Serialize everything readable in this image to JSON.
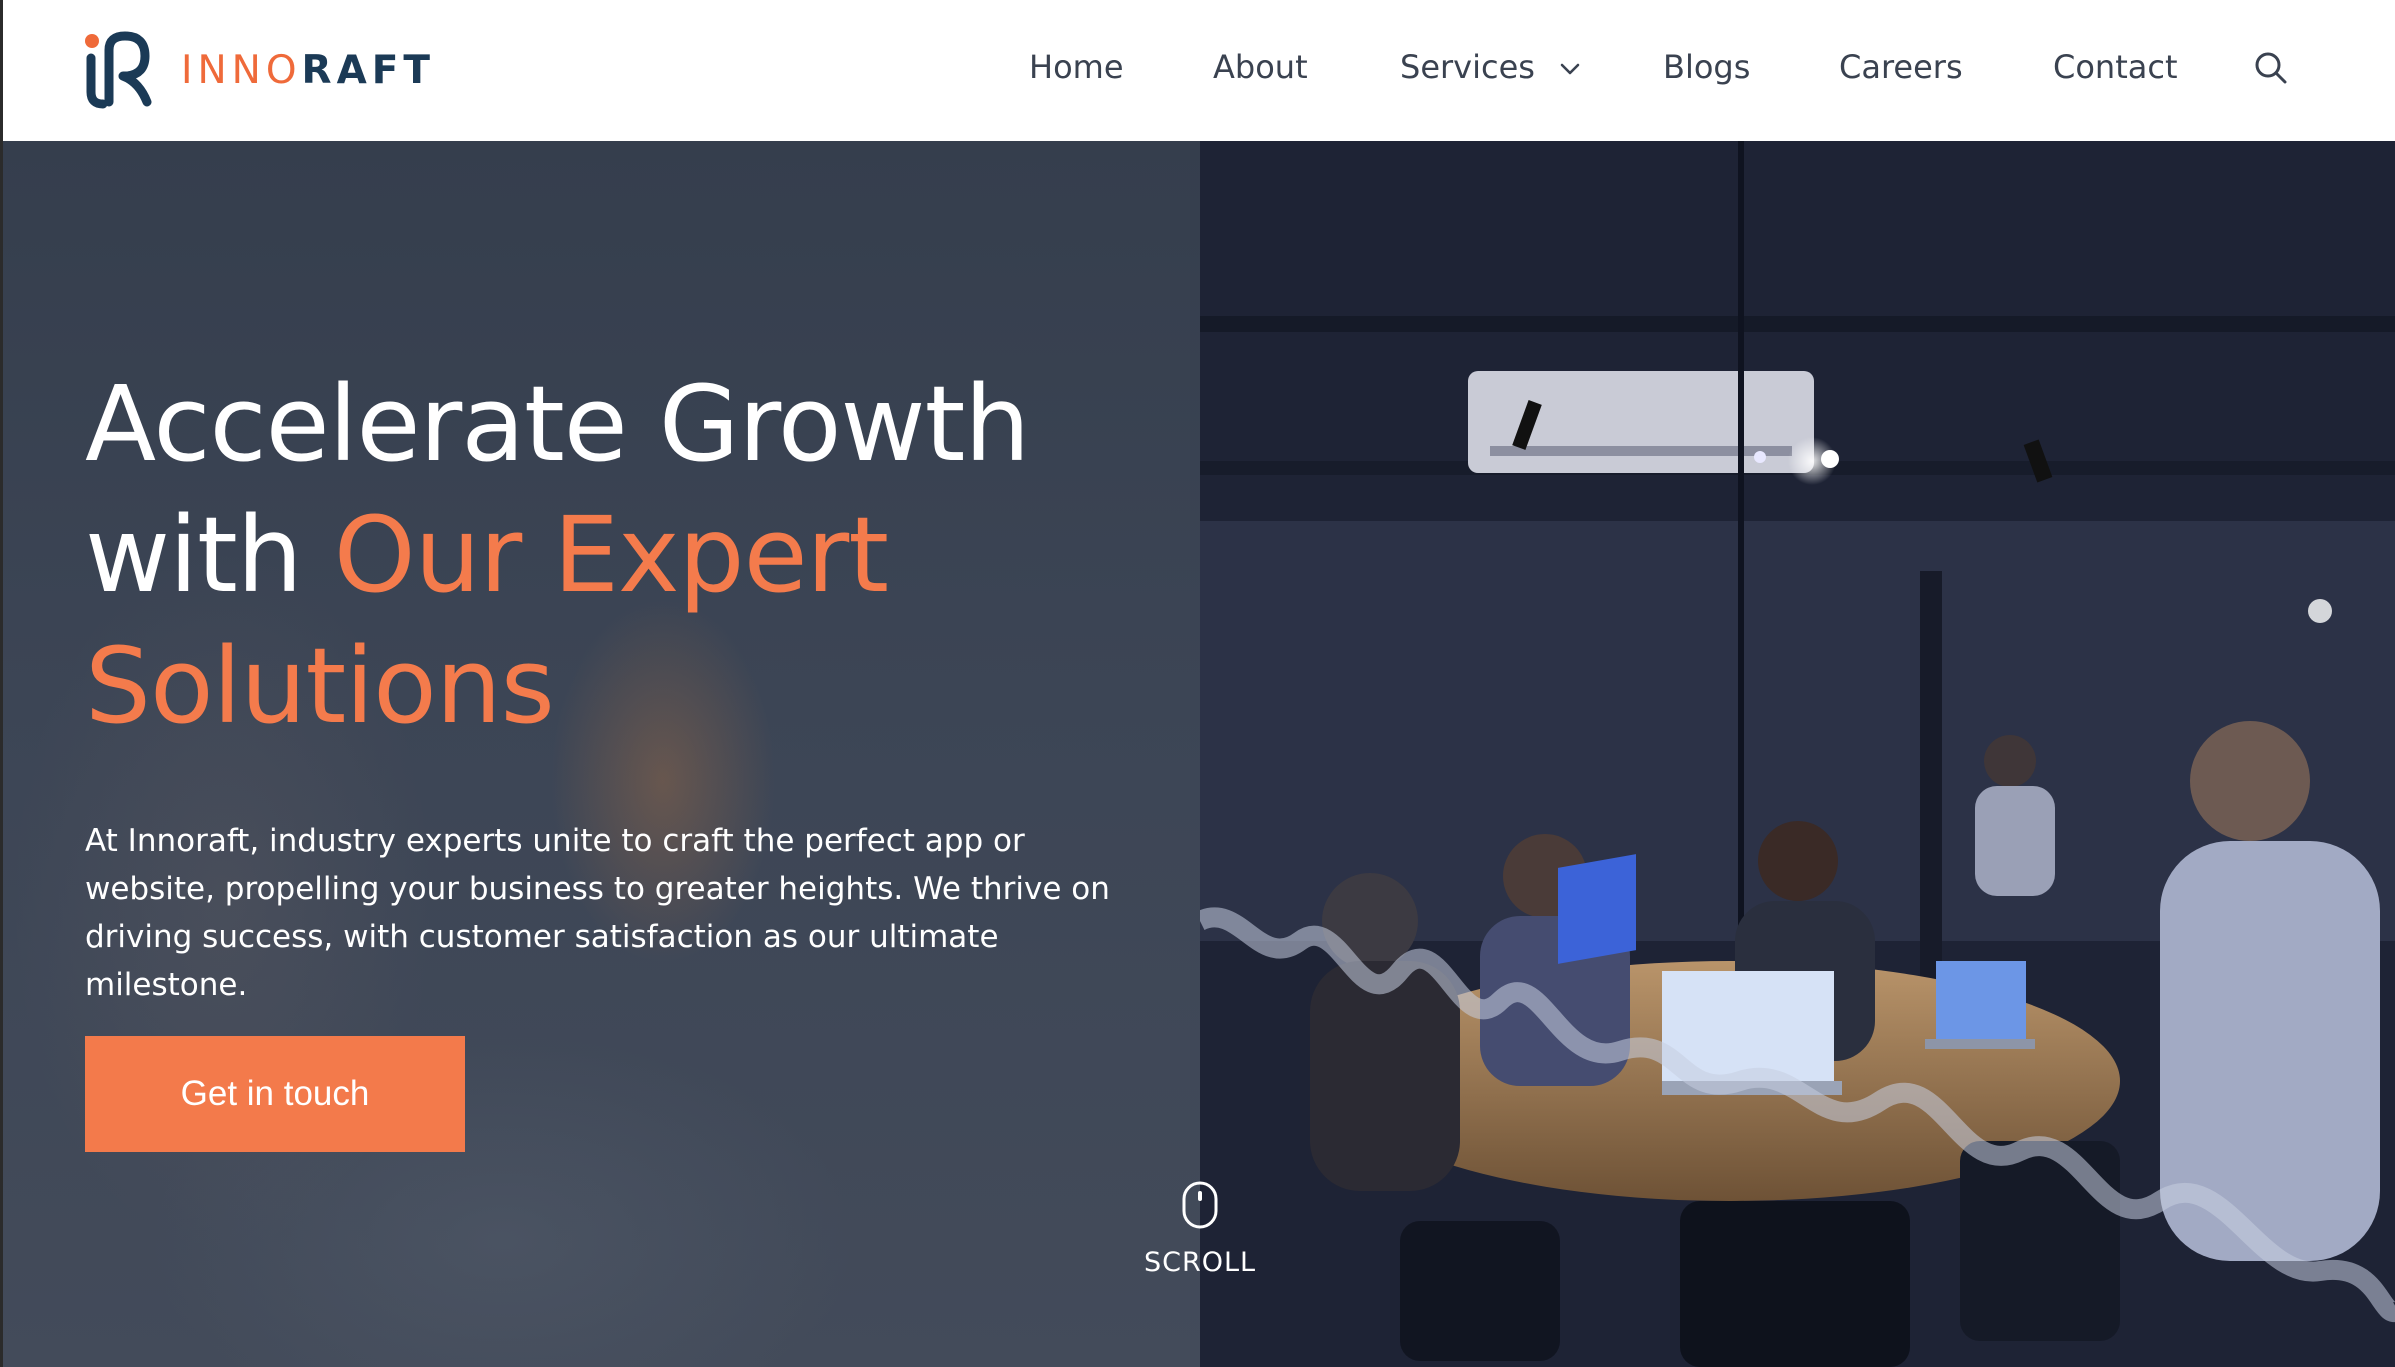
{
  "brand": {
    "name_part1": "INNO",
    "name_part2": "RAFT",
    "logo_icon": "innoraft-logo-icon",
    "color_primary": "#1b3a56",
    "color_accent": "#ef6a3a"
  },
  "nav": {
    "items": [
      {
        "label": "Home"
      },
      {
        "label": "About"
      },
      {
        "label": "Services",
        "icon": "chevron-down-icon"
      },
      {
        "label": "Blogs"
      },
      {
        "label": "Careers"
      },
      {
        "label": "Contact"
      }
    ],
    "search_icon": "search-icon"
  },
  "hero": {
    "title_line1": "Accelerate Growth",
    "title_line2_prefix": "with ",
    "title_line2_accent": "Our Expert",
    "title_line3_accent": "Solutions",
    "description": "At Innoraft, industry experts unite to craft the perfect app or website, propelling your business to greater heights. We thrive on driving success, with customer satisfaction as our ultimate milestone.",
    "cta_label": "Get in touch",
    "scroll_label": "SCROLL",
    "scroll_icon": "mouse-icon",
    "accent_color": "#f47b4c",
    "image_description": "team-meeting-photo"
  }
}
